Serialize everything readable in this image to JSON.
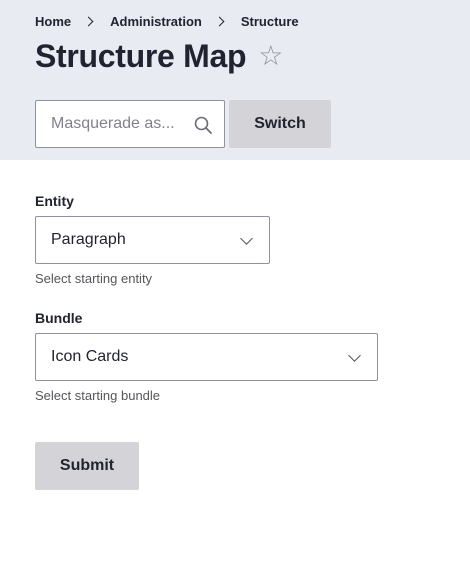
{
  "breadcrumb": [
    {
      "label": "Home"
    },
    {
      "label": "Administration"
    },
    {
      "label": "Structure"
    }
  ],
  "page": {
    "title": "Structure Map",
    "favorite_icon": "star-outline-icon"
  },
  "masquerade": {
    "placeholder": "Masquerade as...",
    "value": "",
    "search_icon": "search-icon",
    "switch_label": "Switch"
  },
  "form": {
    "entity": {
      "label": "Entity",
      "selected": "Paragraph",
      "description": "Select starting entity"
    },
    "bundle": {
      "label": "Bundle",
      "selected": "Icon Cards",
      "description": "Select starting bundle"
    },
    "submit_label": "Submit"
  },
  "colors": {
    "header_bg": "#e8ebf2",
    "button_bg": "#d4d4d8",
    "text": "#222330",
    "border": "#8e929c"
  }
}
